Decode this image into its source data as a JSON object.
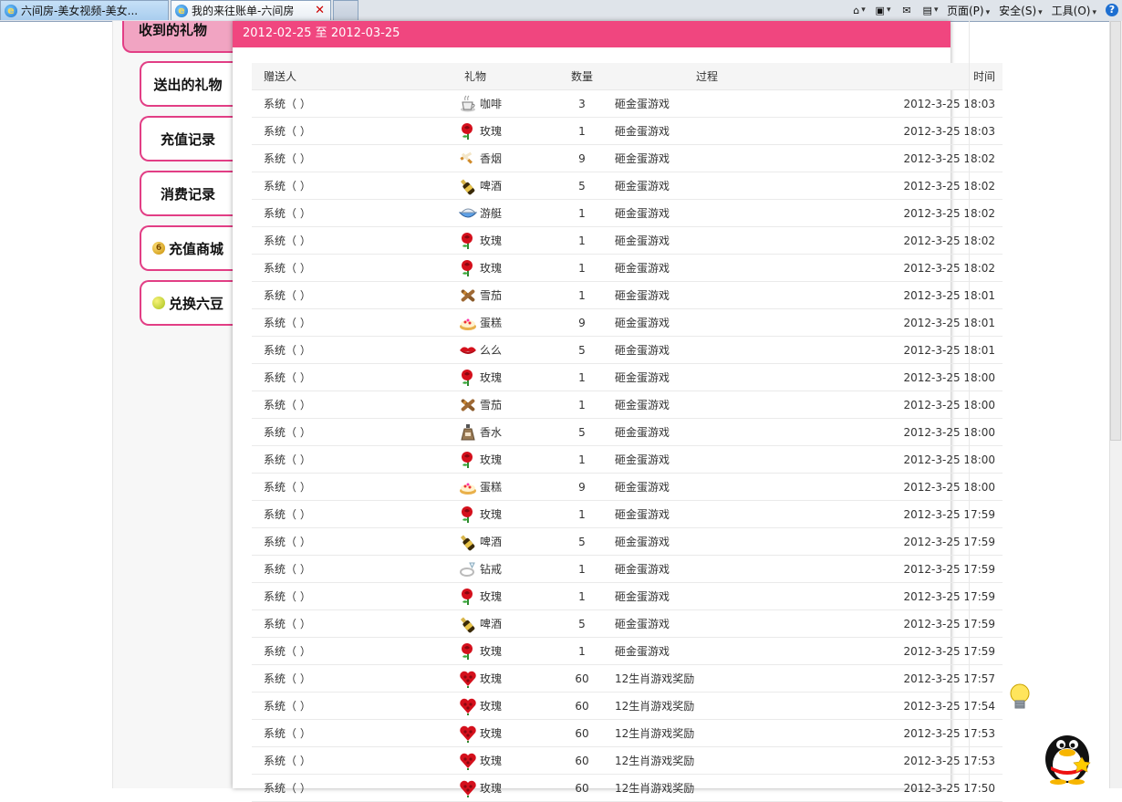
{
  "browser": {
    "tabs": [
      {
        "title": "六间房-美女视频-美女..."
      },
      {
        "title": "我的来往账单-六间房"
      }
    ],
    "toolbar": {
      "page": "页面(P)",
      "safety": "安全(S)",
      "tools": "工具(O)"
    }
  },
  "sidebar": {
    "active": "收到的礼物",
    "items": [
      "送出的礼物",
      "充值记录",
      "消费记录",
      "充值商城",
      "兑换六豆"
    ]
  },
  "panel": {
    "date_range": "2012-02-25 至 2012-03-25",
    "columns": [
      "赠送人",
      "礼物",
      "数量",
      "过程",
      "时间"
    ],
    "rows": [
      {
        "sender": "系统（ ）",
        "icon": "coffee-icon",
        "gift": "咖啡",
        "qty": "3",
        "process": "砸金蛋游戏",
        "time": "2012-3-25 18:03"
      },
      {
        "sender": "系统（ ）",
        "icon": "rose-icon",
        "gift": "玫瑰",
        "qty": "1",
        "process": "砸金蛋游戏",
        "time": "2012-3-25 18:03"
      },
      {
        "sender": "系统（ ）",
        "icon": "cigarette-icon",
        "gift": "香烟",
        "qty": "9",
        "process": "砸金蛋游戏",
        "time": "2012-3-25 18:02"
      },
      {
        "sender": "系统（ ）",
        "icon": "beer-icon",
        "gift": "啤酒",
        "qty": "5",
        "process": "砸金蛋游戏",
        "time": "2012-3-25 18:02"
      },
      {
        "sender": "系统（ ）",
        "icon": "yacht-icon",
        "gift": "游艇",
        "qty": "1",
        "process": "砸金蛋游戏",
        "time": "2012-3-25 18:02"
      },
      {
        "sender": "系统（ ）",
        "icon": "rose-icon",
        "gift": "玫瑰",
        "qty": "1",
        "process": "砸金蛋游戏",
        "time": "2012-3-25 18:02"
      },
      {
        "sender": "系统（ ）",
        "icon": "rose-icon",
        "gift": "玫瑰",
        "qty": "1",
        "process": "砸金蛋游戏",
        "time": "2012-3-25 18:02"
      },
      {
        "sender": "系统（ ）",
        "icon": "cigar-icon",
        "gift": "雪茄",
        "qty": "1",
        "process": "砸金蛋游戏",
        "time": "2012-3-25 18:01"
      },
      {
        "sender": "系统（ ）",
        "icon": "cake-icon",
        "gift": "蛋糕",
        "qty": "9",
        "process": "砸金蛋游戏",
        "time": "2012-3-25 18:01"
      },
      {
        "sender": "系统（ ）",
        "icon": "kiss-icon",
        "gift": "么么",
        "qty": "5",
        "process": "砸金蛋游戏",
        "time": "2012-3-25 18:01"
      },
      {
        "sender": "系统（ ）",
        "icon": "rose-icon",
        "gift": "玫瑰",
        "qty": "1",
        "process": "砸金蛋游戏",
        "time": "2012-3-25 18:00"
      },
      {
        "sender": "系统（ ）",
        "icon": "cigar-icon",
        "gift": "雪茄",
        "qty": "1",
        "process": "砸金蛋游戏",
        "time": "2012-3-25 18:00"
      },
      {
        "sender": "系统（ ）",
        "icon": "perfume-icon",
        "gift": "香水",
        "qty": "5",
        "process": "砸金蛋游戏",
        "time": "2012-3-25 18:00"
      },
      {
        "sender": "系统（ ）",
        "icon": "rose-icon",
        "gift": "玫瑰",
        "qty": "1",
        "process": "砸金蛋游戏",
        "time": "2012-3-25 18:00"
      },
      {
        "sender": "系统（ ）",
        "icon": "cake-icon",
        "gift": "蛋糕",
        "qty": "9",
        "process": "砸金蛋游戏",
        "time": "2012-3-25 18:00"
      },
      {
        "sender": "系统（ ）",
        "icon": "rose-icon",
        "gift": "玫瑰",
        "qty": "1",
        "process": "砸金蛋游戏",
        "time": "2012-3-25 17:59"
      },
      {
        "sender": "系统（ ）",
        "icon": "beer-icon",
        "gift": "啤酒",
        "qty": "5",
        "process": "砸金蛋游戏",
        "time": "2012-3-25 17:59"
      },
      {
        "sender": "系统（ ）",
        "icon": "ring-icon",
        "gift": "钻戒",
        "qty": "1",
        "process": "砸金蛋游戏",
        "time": "2012-3-25 17:59"
      },
      {
        "sender": "系统（ ）",
        "icon": "rose-icon",
        "gift": "玫瑰",
        "qty": "1",
        "process": "砸金蛋游戏",
        "time": "2012-3-25 17:59"
      },
      {
        "sender": "系统（ ）",
        "icon": "beer-icon",
        "gift": "啤酒",
        "qty": "5",
        "process": "砸金蛋游戏",
        "time": "2012-3-25 17:59"
      },
      {
        "sender": "系统（ ）",
        "icon": "rose-icon",
        "gift": "玫瑰",
        "qty": "1",
        "process": "砸金蛋游戏",
        "time": "2012-3-25 17:59"
      },
      {
        "sender": "系统（ ）",
        "icon": "rose-heart-icon",
        "gift": "玫瑰",
        "qty": "60",
        "process": "12生肖游戏奖励",
        "time": "2012-3-25 17:57"
      },
      {
        "sender": "系统（ ）",
        "icon": "rose-heart-icon",
        "gift": "玫瑰",
        "qty": "60",
        "process": "12生肖游戏奖励",
        "time": "2012-3-25 17:54"
      },
      {
        "sender": "系统（ ）",
        "icon": "rose-heart-icon",
        "gift": "玫瑰",
        "qty": "60",
        "process": "12生肖游戏奖励",
        "time": "2012-3-25 17:53"
      },
      {
        "sender": "系统（ ）",
        "icon": "rose-heart-icon",
        "gift": "玫瑰",
        "qty": "60",
        "process": "12生肖游戏奖励",
        "time": "2012-3-25 17:53"
      },
      {
        "sender": "系统（ ）",
        "icon": "rose-heart-icon",
        "gift": "玫瑰",
        "qty": "60",
        "process": "12生肖游戏奖励",
        "time": "2012-3-25 17:50"
      }
    ]
  },
  "colors": {
    "accent": "#f0467f",
    "link": "#e0358a",
    "nav_border": "#e23e85"
  }
}
